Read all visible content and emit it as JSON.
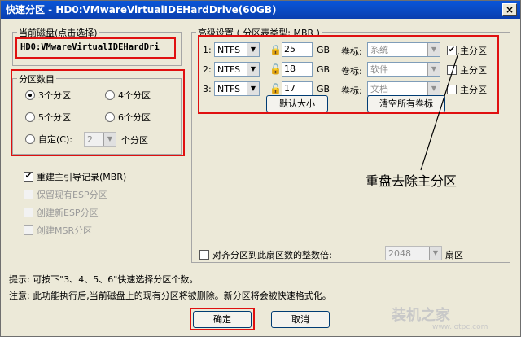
{
  "title": "快速分区 - HD0:VMwareVirtualIDEHardDrive(60GB)",
  "close_glyph": "×",
  "disk_group": {
    "legend": "当前磁盘(点击选择)",
    "disk_name": "HD0:VMwareVirtualIDEHardDri"
  },
  "count_group": {
    "legend": "分区数目",
    "options": [
      "3个分区",
      "4个分区",
      "5个分区",
      "6个分区"
    ],
    "custom_label": "自定(C):",
    "custom_value": "2",
    "custom_suffix": "个分区",
    "selected": "3个分区"
  },
  "options": {
    "rebuild_mbr": "重建主引导记录(MBR)",
    "keep_esp": "保留现有ESP分区",
    "create_esp": "创建新ESP分区",
    "create_msr": "创建MSR分区"
  },
  "advanced": {
    "legend": "高级设置 ( 分区表类型: MBR )",
    "rows": [
      {
        "num": "1:",
        "fs": "NTFS",
        "size": "25",
        "unit": "GB",
        "label_caption": "卷标:",
        "label_value": "系统",
        "primary": "主分区",
        "primary_checked": true
      },
      {
        "num": "2:",
        "fs": "NTFS",
        "size": "18",
        "unit": "GB",
        "label_caption": "卷标:",
        "label_value": "软件",
        "primary": "主分区",
        "primary_checked": false
      },
      {
        "num": "3:",
        "fs": "NTFS",
        "size": "17",
        "unit": "GB",
        "label_caption": "卷标:",
        "label_value": "文档",
        "primary": "主分区",
        "primary_checked": false
      }
    ],
    "default_size_button": "默认大小",
    "clear_labels_button": "清空所有卷标"
  },
  "annotation": "重盘去除主分区",
  "align": {
    "label": "对齐分区到此扇区数的整数倍:",
    "value": "2048",
    "suffix": "扇区"
  },
  "hint": "提示: 可按下\"3、4、5、6\"快速选择分区个数。",
  "note": "注意: 此功能执行后,当前磁盘上的现有分区将被删除。新分区将会被快速格式化。",
  "ok_button": "确定",
  "cancel_button": "取消",
  "watermark": "装机之家",
  "watermark_url": "www.lotpc.com",
  "colors": {
    "highlight": "#e01010",
    "titlebar": "#0a4fc8"
  }
}
